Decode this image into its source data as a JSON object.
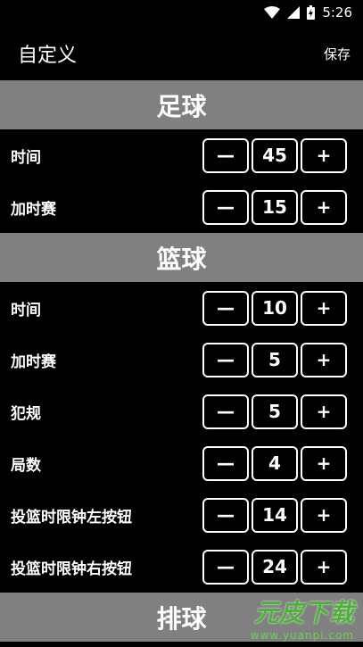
{
  "status_bar": {
    "time": "5:26"
  },
  "app_bar": {
    "title": "自定义",
    "save_label": "保存"
  },
  "sections": [
    {
      "title": "足球",
      "rows": [
        {
          "label": "时间",
          "value": "45"
        },
        {
          "label": "加时赛",
          "value": "15"
        }
      ]
    },
    {
      "title": "篮球",
      "rows": [
        {
          "label": "时间",
          "value": "10"
        },
        {
          "label": "加时赛",
          "value": "5"
        },
        {
          "label": "犯规",
          "value": "5"
        },
        {
          "label": "局数",
          "value": "4"
        },
        {
          "label": "投篮时限钟左按钮",
          "value": "14"
        },
        {
          "label": "投篮时限钟右按钮",
          "value": "24"
        }
      ]
    },
    {
      "title": "排球",
      "rows": []
    }
  ],
  "stepper": {
    "minus": "—",
    "plus": "+"
  },
  "watermark": {
    "main": "元皮下载",
    "url": "www.yuanpi.com"
  }
}
